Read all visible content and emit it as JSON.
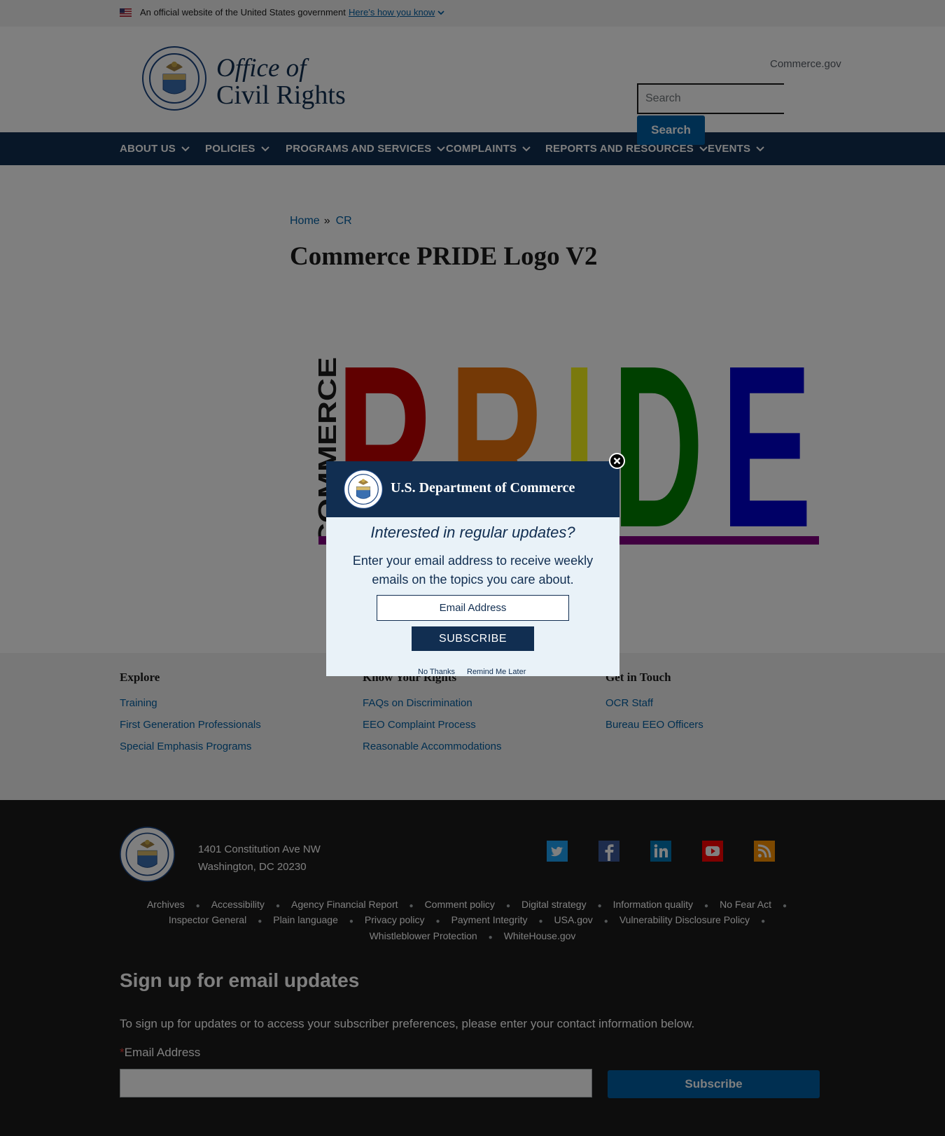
{
  "banner": {
    "official_text": "An official website of the United States government",
    "how_know": "Here’s how you know"
  },
  "header": {
    "title_line1": "Office of",
    "title_line2": "Civil Rights",
    "commerce_link": "Commerce.gov",
    "search_placeholder": "Search",
    "search_button": "Search"
  },
  "nav": {
    "items": [
      "ABOUT US",
      "POLICIES",
      "PROGRAMS AND SERVICES",
      "COMPLAINTS",
      "REPORTS AND RESOURCES",
      "EVENTS"
    ]
  },
  "breadcrumb": {
    "home": "Home",
    "sep": "»",
    "current": "CR"
  },
  "page": {
    "title": "Commerce PRIDE Logo V2",
    "image": {
      "side_text": "COMMERCE",
      "letters": [
        "P",
        "R",
        "I",
        "D",
        "E"
      ],
      "colors": [
        "#c00000",
        "#e8730c",
        "#f5f21a",
        "#008000",
        "#0000cc",
        "#800080"
      ]
    }
  },
  "footer_links": {
    "explore": {
      "heading": "Explore",
      "links": [
        "Training",
        "First Generation Professionals",
        "Special Emphasis Programs"
      ]
    },
    "rights": {
      "heading": "Know Your Rights",
      "links": [
        "FAQs on Discrimination",
        "EEO Complaint Process",
        "Reasonable Accommodations"
      ]
    },
    "touch": {
      "heading": "Get in Touch",
      "links": [
        "OCR Staff",
        "Bureau EEO Officers"
      ]
    }
  },
  "footer": {
    "address_line1": "1401 Constitution Ave NW",
    "address_line2": "Washington, DC 20230",
    "social": [
      "twitter-icon",
      "facebook-icon",
      "linkedin-icon",
      "youtube-icon",
      "rss-icon"
    ],
    "row1": [
      "Archives",
      "Accessibility",
      "Agency Financial Report",
      "Comment policy",
      "Digital strategy",
      "Information quality",
      "No Fear Act"
    ],
    "row2": [
      "Inspector General",
      "Plain language",
      "Privacy policy",
      "Payment Integrity",
      "USA.gov",
      "Vulnerability Disclosure Policy"
    ],
    "row3": [
      "Whistleblower Protection",
      "WhiteHouse.gov"
    ],
    "signup_title": "Sign up for email updates",
    "signup_desc": "To sign up for updates or to access your subscriber preferences, please enter your contact information below.",
    "email_required": "*",
    "email_label": "Email Address",
    "subscribe_button": "Subscribe"
  },
  "modal": {
    "dept": "U.S. Department of Commerce",
    "question": "Interested in regular updates?",
    "description": "Enter your email address to receive weekly emails on the topics you care about.",
    "email_placeholder": "Email Address",
    "subscribe": "SUBSCRIBE",
    "no_thanks": "No Thanks",
    "remind": "Remind Me Later"
  }
}
